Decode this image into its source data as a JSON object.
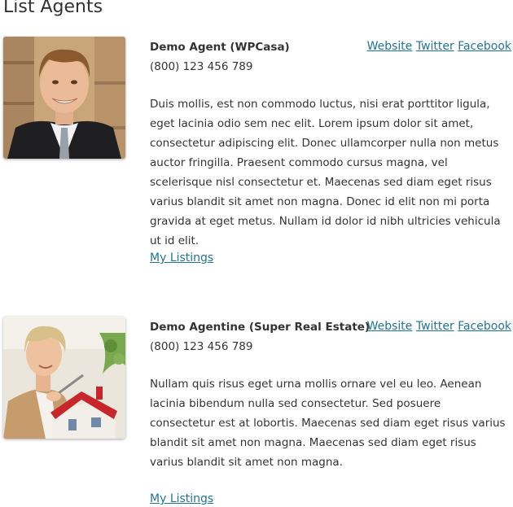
{
  "page": {
    "title": "List Agents"
  },
  "agents": [
    {
      "name": "Demo Agent (WPCasa)",
      "phone": "(800) 123 456 789",
      "links": {
        "website": "Website",
        "twitter": "Twitter",
        "facebook": "Facebook"
      },
      "description": "Duis mollis, est non commodo luctus, nisi erat porttitor ligula, eget lacinia odio sem nec elit. Lorem ipsum dolor sit amet, consectetur adipiscing elit. Donec ullamcorper nulla non metus auctor fringilla. Praesent commodo cursus magna, vel scelerisque nisl consectetur et. Maecenas sed diam eget risus varius blandit sit amet non magna. Donec id elit non mi porta gravida at eget metus. Nullam id dolor id nibh ultricies vehicula ut id elit.",
      "listings_label": "My Listings",
      "photo_icon": "agent-male-photo"
    },
    {
      "name": "Demo Agentine (Super Real Estate)",
      "phone": "(800) 123 456 789",
      "links": {
        "website": "Website",
        "twitter": "Twitter",
        "facebook": "Facebook"
      },
      "description": "Nullam quis risus eget urna mollis ornare vel eu leo. Aenean lacinia bibendum nulla sed consectetur. Sed posuere consectetur est at lobortis. Maecenas sed diam eget risus varius blandit sit amet non magna. Maecenas sed diam eget risus varius blandit sit amet non magna.",
      "listings_label": "My Listings",
      "photo_icon": "agent-female-photo"
    }
  ],
  "colors": {
    "link": "#21759b",
    "text": "#333333"
  }
}
